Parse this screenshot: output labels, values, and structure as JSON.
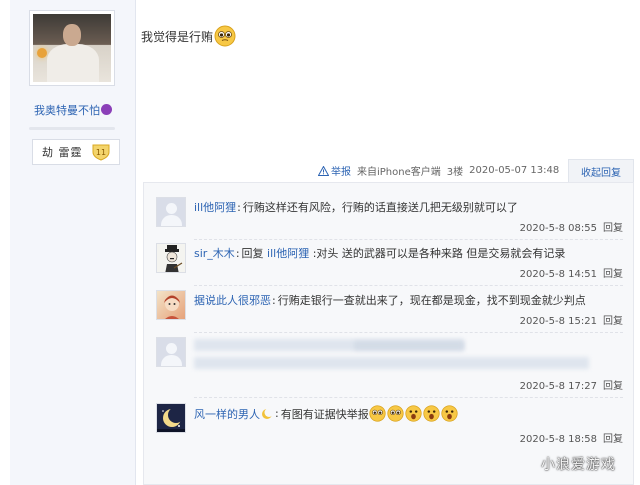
{
  "author": {
    "name": "我奥特曼不怕",
    "level_name": "劫 雷霆",
    "level": "11"
  },
  "post": {
    "text": "我觉得是行贿",
    "report_label": "举报",
    "source": "来自iPhone客户端",
    "floor": "3楼",
    "date": "2020-05-07 13:48",
    "toggle_label": "收起回复"
  },
  "replies": [
    {
      "user": "ill他阿狸",
      "sep": ":",
      "text": "行贿这样还有风险，行贿的话直接送几把无级别就可以了",
      "time": "2020-5-8 08:55",
      "reply_label": "回复"
    },
    {
      "user": "sir_木木",
      "sep": ":",
      "reply_word": "回复",
      "reply_to": "ill他阿狸",
      "text": ":对头 送的武器可以是各种来路 但是交易就会有记录",
      "time": "2020-5-8 14:51",
      "reply_label": "回复"
    },
    {
      "user": "据说此人很邪恶",
      "sep": ":",
      "text": "行贿走银行一查就出来了，现在都是现金，找不到现金就少判点",
      "time": "2020-5-8 15:21",
      "reply_label": "回复"
    },
    {
      "user": "",
      "text": "",
      "time": "2020-5-8 17:27",
      "reply_label": "回复"
    },
    {
      "user": "风一样的男人",
      "sep": ":",
      "text": "有图有证据快举报",
      "time": "2020-5-8 18:58",
      "reply_label": "回复"
    }
  ],
  "watermark": "小浪爱游戏"
}
